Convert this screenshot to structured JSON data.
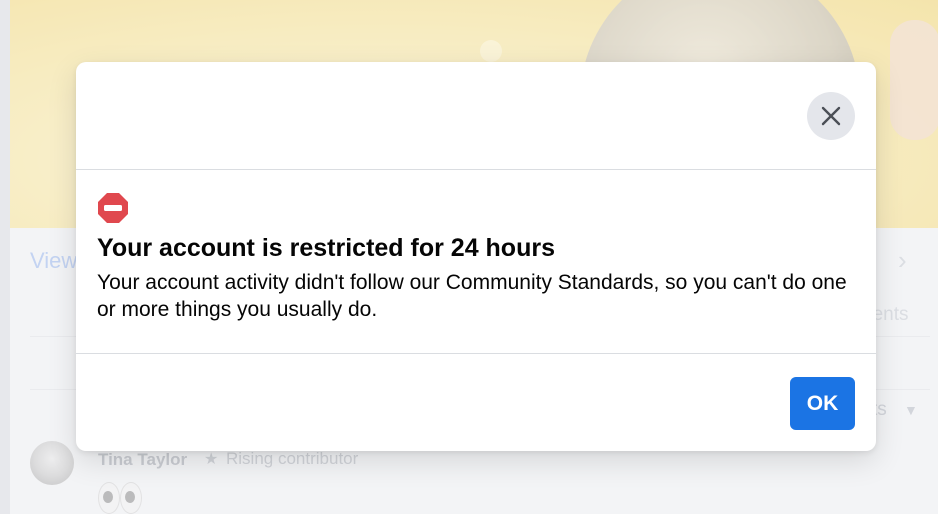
{
  "background": {
    "view_link": "View",
    "right_peek_top": "n",
    "right_peek_middle": "nents",
    "sort_peek": "ts",
    "commenter": {
      "name": "Tina Taylor",
      "badge": "Rising contributor"
    }
  },
  "modal": {
    "title": "Your account is restricted for 24 hours",
    "body": "Your account activity didn't follow our Community Standards, so you can't do one or more things you usually do.",
    "ok_label": "OK",
    "icons": {
      "close": "close-icon",
      "restricted": "restricted-icon"
    }
  },
  "colors": {
    "primary_button": "#1b74e4",
    "restricted_icon": "#e0484e",
    "close_button_bg": "#e4e6eb"
  }
}
